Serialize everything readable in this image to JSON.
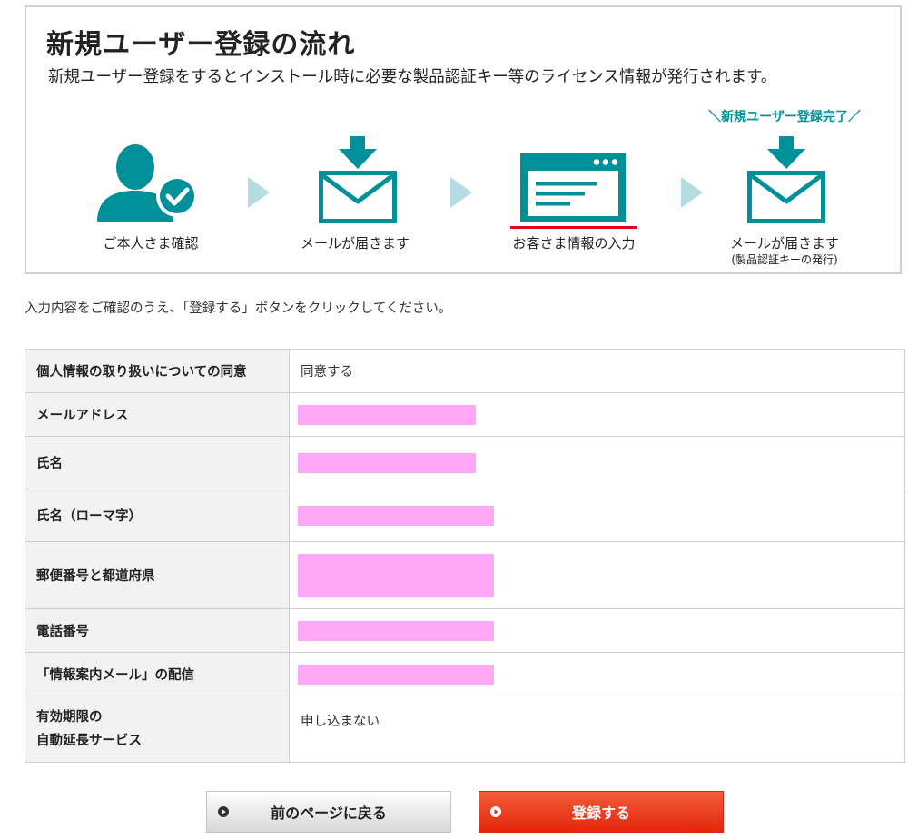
{
  "flow": {
    "title": "新規ユーザー登録の流れ",
    "subtitle": "新規ユーザー登録をするとインストール時に必要な製品認証キー等のライセンス情報が発行されます。",
    "complete_tag": "＼新規ユーザー登録完了／",
    "steps": [
      {
        "label": "ご本人さま確認",
        "icon": "user-check-icon"
      },
      {
        "label": "メールが届きます",
        "icon": "mail-download-icon"
      },
      {
        "label": "お客さま情報の入力",
        "icon": "browser-form-icon",
        "active": true
      },
      {
        "label": "メールが届きます",
        "note": "(製品認証キーの発行)",
        "icon": "mail-download-icon"
      }
    ]
  },
  "instruction": "入力内容をご確認のうえ、「登録する」ボタンをクリックしてください。",
  "table": {
    "rows": [
      {
        "label": "個人情報の取り扱いについての同意",
        "value": "同意する"
      },
      {
        "label": "メールアドレス",
        "masked": true
      },
      {
        "label": "氏名",
        "masked": true
      },
      {
        "label": "氏名（ローマ字）",
        "masked": true
      },
      {
        "label": "郵便番号と都道府県",
        "masked": true
      },
      {
        "label": "電話番号",
        "masked": true
      },
      {
        "label": "「情報案内メール」の配信",
        "masked": true
      },
      {
        "label_lines": [
          "有効期限の",
          "自動延長サービス"
        ],
        "value": "申し込まない"
      }
    ]
  },
  "buttons": {
    "back_label": "前のページに戻る",
    "submit_label": "登録する"
  },
  "colors": {
    "accent_teal": "#009099",
    "active_red": "#e60012",
    "masked_pink": "#ffa8f8",
    "submit_red": "#e2270c"
  }
}
